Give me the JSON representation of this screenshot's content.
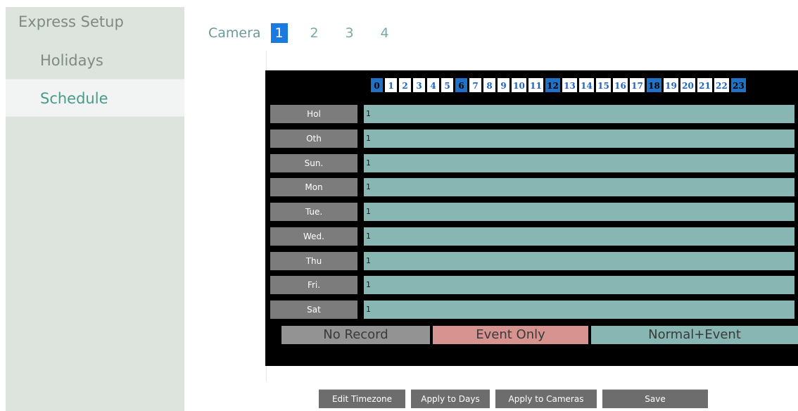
{
  "sidebar": {
    "items": [
      {
        "label": "Express Setup"
      },
      {
        "label": "Holidays"
      },
      {
        "label": "Schedule"
      }
    ]
  },
  "camera": {
    "label": "Camera",
    "tabs": [
      "1",
      "2",
      "3",
      "4"
    ],
    "active": "1"
  },
  "hours": [
    "0",
    "1",
    "2",
    "3",
    "4",
    "5",
    "6",
    "7",
    "8",
    "9",
    "10",
    "11",
    "12",
    "13",
    "14",
    "15",
    "16",
    "17",
    "18",
    "19",
    "20",
    "21",
    "22",
    "23"
  ],
  "days": [
    {
      "label": "Hol",
      "value": "1"
    },
    {
      "label": "Oth",
      "value": "1"
    },
    {
      "label": "Sun.",
      "value": "1"
    },
    {
      "label": "Mon",
      "value": "1"
    },
    {
      "label": "Tue.",
      "value": "1"
    },
    {
      "label": "Wed.",
      "value": "1"
    },
    {
      "label": "Thu",
      "value": "1"
    },
    {
      "label": "Fri.",
      "value": "1"
    },
    {
      "label": "Sat",
      "value": "1"
    }
  ],
  "legend": {
    "no_record": "No Record",
    "event_only": "Event Only",
    "normal_event": "Normal+Event"
  },
  "buttons": {
    "edit_timezone": "Edit Timezone",
    "apply_days": "Apply to Days",
    "apply_cameras": "Apply to Cameras",
    "save": "Save"
  },
  "colors": {
    "accent": "#1b7ae0",
    "normal_event": "#88b6b2",
    "event_only": "#d69390",
    "no_record": "#939393"
  }
}
